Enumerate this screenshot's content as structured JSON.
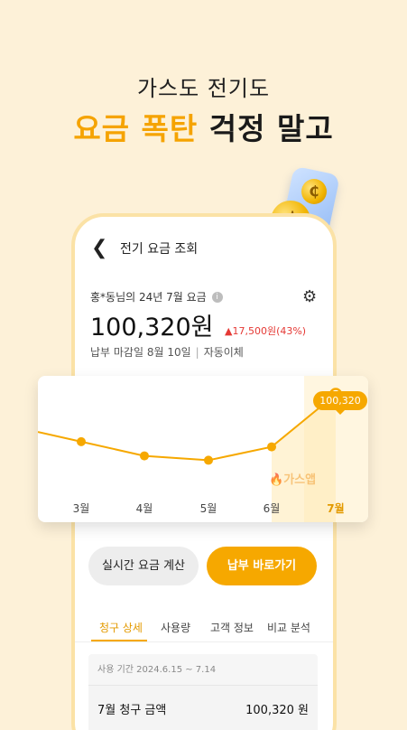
{
  "headline": {
    "line1": "가스도 전기도",
    "line2_accent": "요금 폭탄",
    "line2_dark": "걱정 말고"
  },
  "app": {
    "title": "전기 요금 조회",
    "bill_header": "홍*동님의 24년 7월 요금",
    "amount": "100,320원",
    "delta": "▲17,500원(43%)",
    "due_date": "납부 마감일 8월 10일",
    "payment_method": "자동이체",
    "sep": "|"
  },
  "chart_data": {
    "type": "line",
    "categories": [
      "3월",
      "4월",
      "5월",
      "6월",
      "7월"
    ],
    "values": [
      82000,
      76500,
      74800,
      80000,
      100320
    ],
    "highlight_label": "100,320",
    "highlight_index": 4,
    "watermark": "가스앱",
    "ylim": [
      62000,
      104000
    ],
    "accent": "#f6a800"
  },
  "buttons": {
    "realtime": "실시간 요금 계산",
    "pay": "납부 바로가기"
  },
  "tabs": [
    "청구 상세",
    "사용량",
    "고객 정보",
    "비교 분석"
  ],
  "usage_period": "사용 기간 2024.6.15 ~ 7.14",
  "total": {
    "label": "7월 청구 금액",
    "value": "100,320 원"
  }
}
